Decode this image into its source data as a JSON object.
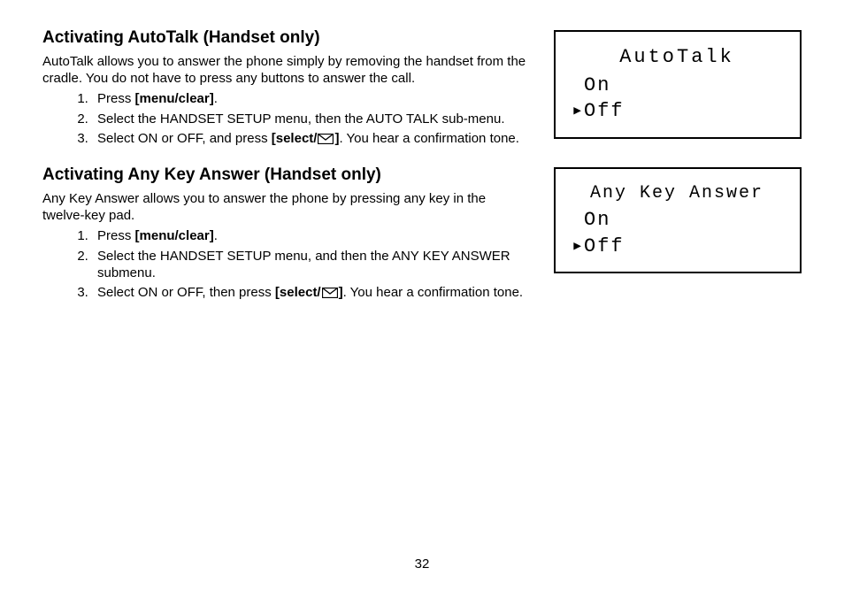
{
  "section1": {
    "heading": "Activating AutoTalk (Handset only)",
    "intro": "AutoTalk allows you to answer the phone simply by removing the handset from the cradle. You do not have to press any buttons to answer the call.",
    "step1_a": "Press ",
    "step1_b": "[menu/clear]",
    "step1_c": ".",
    "step2": "Select the HANDSET SETUP menu, then the AUTO TALK sub-menu.",
    "step3_a": "Select ON or OFF, and press ",
    "step3_btn_a": "[select/",
    "step3_btn_b": "]",
    "step3_b": ". You hear a confirma­tion tone.",
    "lcd_title": "AutoTalk",
    "lcd_on": "On",
    "lcd_off": "Off"
  },
  "section2": {
    "heading": "Activating Any Key Answer (Handset only)",
    "intro": "Any Key Answer allows you to answer the phone by pressing any key in the twelve-key pad.",
    "step1_a": "Press ",
    "step1_b": "[menu/clear]",
    "step1_c": ".",
    "step2": "Select the HANDSET SETUP menu, and then the ANY KEY ANSWER submenu.",
    "step3_a": "Select ON or OFF, then press ",
    "step3_btn_a": "[select/",
    "step3_btn_b": "]",
    "step3_b": ". You hear a confirma­tion tone.",
    "lcd_title": "Any Key Answer",
    "lcd_on": "On",
    "lcd_off": "Off"
  },
  "page_number": "32"
}
